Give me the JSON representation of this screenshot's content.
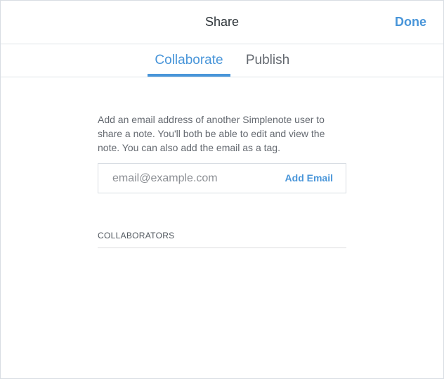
{
  "dialog": {
    "title": "Share",
    "done_label": "Done"
  },
  "tabs": [
    {
      "label": "Collaborate",
      "active": true
    },
    {
      "label": "Publish",
      "active": false
    }
  ],
  "collaborate": {
    "description": "Add an email address of another Simplenote user to share a note. You'll both be able to edit and view the note. You can also add the email as a tag.",
    "email_placeholder": "email@example.com",
    "email_value": "",
    "add_email_label": "Add Email",
    "collaborators_heading": "COLLABORATORS"
  },
  "colors": {
    "accent": "#4895d9",
    "text": "#2c3338",
    "muted": "#646970",
    "border": "#d8dde3"
  }
}
